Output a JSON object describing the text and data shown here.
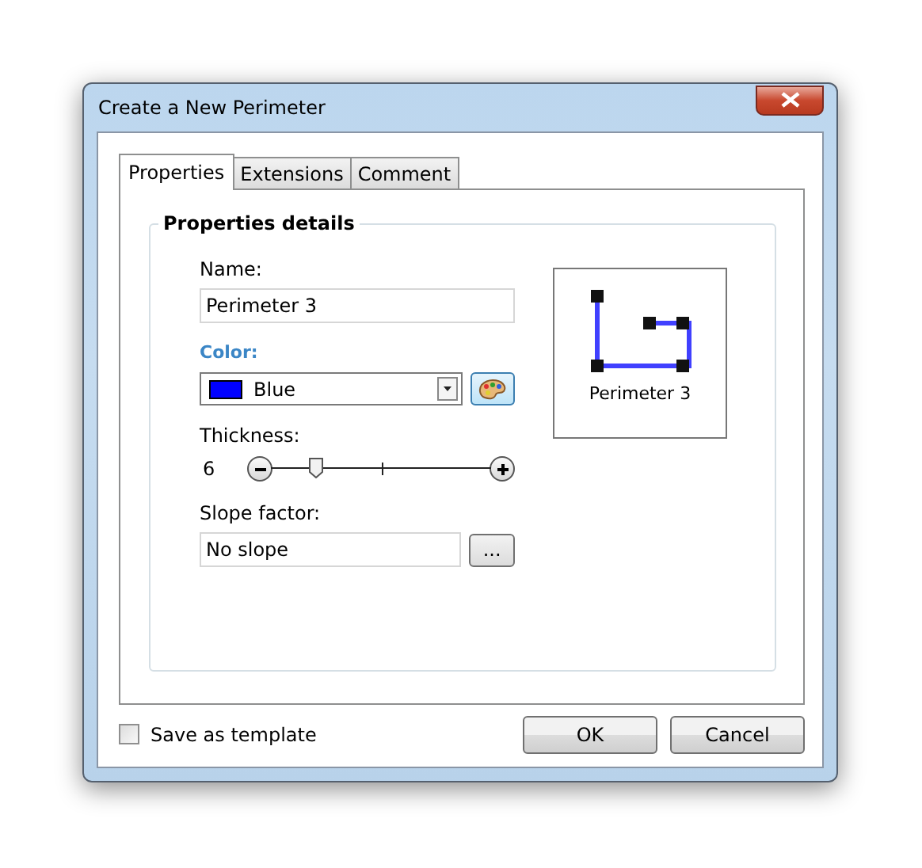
{
  "window": {
    "title": "Create a New Perimeter"
  },
  "tabs": [
    {
      "label": "Properties",
      "selected": true
    },
    {
      "label": "Extensions",
      "selected": false
    },
    {
      "label": "Comment",
      "selected": false
    }
  ],
  "group": {
    "title": "Properties details"
  },
  "name_field": {
    "label": "Name:",
    "value": "Perimeter 3"
  },
  "color_field": {
    "label": "Color:",
    "value": "Blue",
    "color": "#0000ff"
  },
  "thickness": {
    "label": "Thickness:",
    "reading": "6",
    "level": 0.2
  },
  "slope_field": {
    "label": "Slope factor:",
    "value": "No slope",
    "button": "..."
  },
  "preview": {
    "label": "Perimeter 3"
  },
  "save_template": {
    "label": "Save as template",
    "checked": false
  },
  "buttons": [
    "OK",
    "Cancel"
  ]
}
